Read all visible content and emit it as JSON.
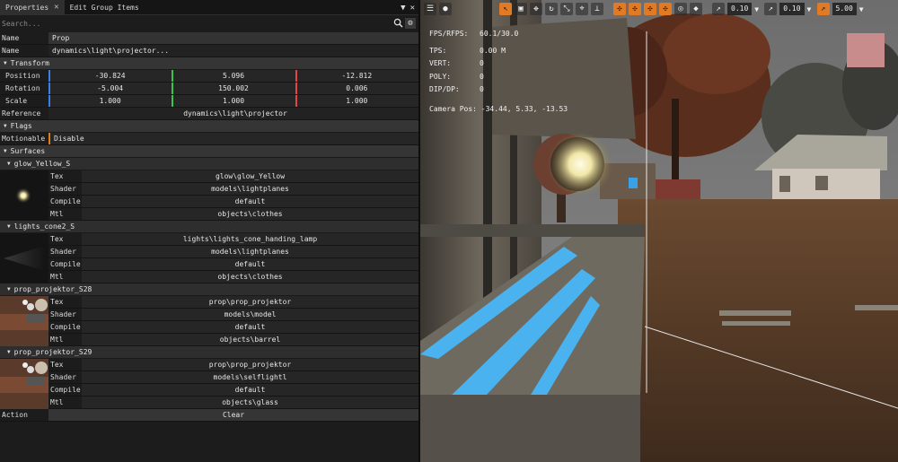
{
  "tabs": [
    {
      "label": "Properties",
      "active": true
    },
    {
      "label": "Edit Group Items",
      "active": false
    }
  ],
  "search": {
    "placeholder": "Search..."
  },
  "name_header": {
    "label": "Name",
    "value": "Prop"
  },
  "name_row": {
    "label": "Name",
    "value": "dynamics\\light\\projector..."
  },
  "transform": {
    "title": "Transform",
    "rows": [
      {
        "label": "Position",
        "x": "-30.824",
        "y": "5.096",
        "z": "-12.812"
      },
      {
        "label": "Rotation",
        "x": "-5.004",
        "y": "150.002",
        "z": "0.006"
      },
      {
        "label": "Scale",
        "x": "1.000",
        "y": "1.000",
        "z": "1.000"
      }
    ]
  },
  "reference": {
    "label": "Reference",
    "value": "dynamics\\light\\projector"
  },
  "flags": {
    "title": "Flags",
    "label": "Motionable",
    "value": "Disable"
  },
  "surfaces": {
    "title": "Surfaces",
    "items": [
      {
        "name": "glow_Yellow_S",
        "tex": "glow\\glow_Yellow",
        "shader": "models\\lightplanes",
        "compile": "default",
        "mtl": "objects\\clothes"
      },
      {
        "name": "lights_cone2_S",
        "tex": "lights\\lights_cone_handing_lamp",
        "shader": "models\\lightplanes",
        "compile": "default",
        "mtl": "objects\\clothes"
      },
      {
        "name": "prop_projektor_S28",
        "tex": "prop\\prop_projektor",
        "shader": "models\\model",
        "compile": "default",
        "mtl": "objects\\barrel"
      },
      {
        "name": "prop_projektor_S29",
        "tex": "prop\\prop_projektor",
        "shader": "models\\selflightl",
        "compile": "default",
        "mtl": "objects\\glass"
      }
    ],
    "prop_labels": {
      "tex": "Tex",
      "shader": "Shader",
      "compile": "Compile",
      "mtl": "Mtl"
    }
  },
  "action": {
    "label": "Action",
    "button": "Clear"
  },
  "toolbar": {
    "v1": "0.10",
    "v2": "0.10",
    "v3": "5.00"
  },
  "stats": {
    "fps": {
      "label": "FPS/RFPS:",
      "value": "60.1/30.0"
    },
    "tps": {
      "label": "TPS:",
      "value": "0.00 M"
    },
    "vert": {
      "label": "VERT:",
      "value": "0"
    },
    "poly": {
      "label": "POLY:",
      "value": "0"
    },
    "dip": {
      "label": "DIP/DP:",
      "value": "0"
    },
    "camera": "Camera Pos: -34.44, 5.33, -13.53"
  },
  "colors": {
    "accent": "#e07a25",
    "x_axis": "#3f7de0",
    "y_axis": "#3cc24f",
    "z_axis": "#e04848"
  }
}
